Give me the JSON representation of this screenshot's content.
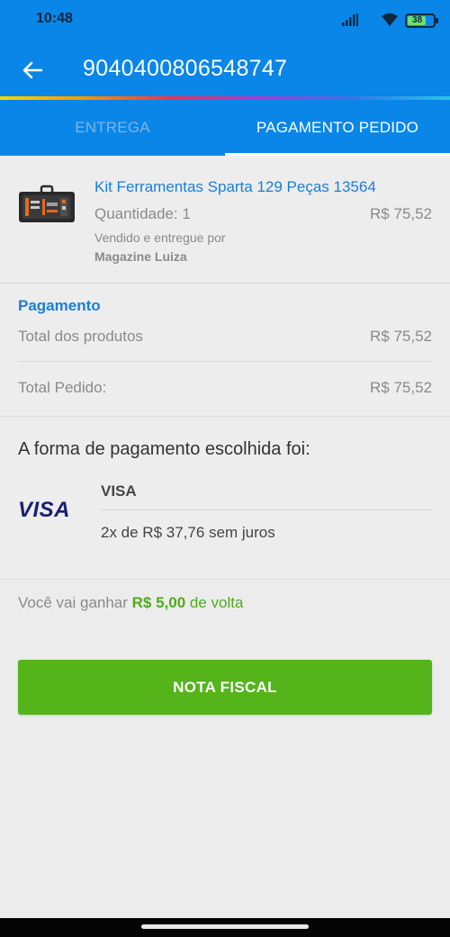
{
  "status_bar": {
    "time": "10:48",
    "battery": "38"
  },
  "header": {
    "title": "9040400806548747"
  },
  "tabs": [
    {
      "label": "ENTREGA"
    },
    {
      "label": "PAGAMENTO PEDIDO"
    }
  ],
  "product": {
    "name": "Kit Ferramentas Sparta 129 Peças 13564",
    "quantity": "Quantidade: 1",
    "price": "R$ 75,52",
    "sold_by": "Vendido e entregue por",
    "seller": "Magazine Luiza"
  },
  "payment": {
    "title": "Pagamento",
    "products_label": "Total dos produtos",
    "products_value": "R$ 75,52",
    "order_label": "Total Pedido:",
    "order_value": "R$ 75,52"
  },
  "method": {
    "title": "A forma de pagamento escolhida foi:",
    "logo": "VISA",
    "card": "VISA",
    "installments": "2x de R$ 37,76 sem juros"
  },
  "cashback": {
    "prefix": "Você vai ganhar ",
    "amount": "R$ 5,00",
    "suffix": " de volta"
  },
  "button": {
    "label": "NOTA FISCAL"
  },
  "colors": {
    "primary": "#0a86e8",
    "link": "#1a7fd6",
    "green": "#54b41a",
    "background": "#ededed"
  },
  "icons": [
    "signal-icon",
    "wifi-icon",
    "battery-icon",
    "back-arrow-icon",
    "product-thumbnail"
  ]
}
